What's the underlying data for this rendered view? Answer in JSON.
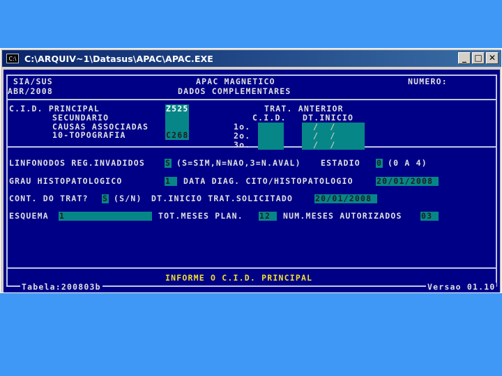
{
  "window": {
    "title": "C:\\ARQUIV~1\\Datasus\\APAC\\APAC.EXE",
    "icon_label": "C:\\",
    "icon": "console-icon"
  },
  "controls": {
    "minimize": "_",
    "maximize": "□",
    "close": "✕"
  },
  "header": {
    "system": "SIA/SUS",
    "period": "ABR/2008",
    "app_title": "APAC MAGNETICO",
    "section": "DADOS COMPLEMENTARES",
    "numero_label": "NUMERO:"
  },
  "cid": {
    "principal_label": "C.I.D. PRINCIPAL",
    "principal_value": "Z525",
    "secundario_label": "SECUNDARIO",
    "causas_label": "CAUSAS ASSOCIADAS",
    "topografia_label": "10-TOPOGRAFIA",
    "topografia_value": "C268"
  },
  "trat_anterior": {
    "title": "TRAT. ANTERIOR",
    "cid_col": "C.I.D.",
    "dt_col": "DT.INICIO",
    "rows": [
      {
        "label": "1o.",
        "date": "/  /"
      },
      {
        "label": "2o.",
        "date": "/  /"
      },
      {
        "label": "3o.",
        "date": "/  /"
      }
    ]
  },
  "linfonodos": {
    "label": "LINFONODOS REG.INVADIDOS",
    "value": "S",
    "hint": "(S=SIM,N=NAO,3=N.AVAL)",
    "estadio_label": "ESTADIO",
    "estadio_value": "0",
    "estadio_hint": "(0 A 4)"
  },
  "grau": {
    "label": "GRAU HISTOPATOLOGICO",
    "value": "1",
    "data_label": "DATA DIAG. CITO/HISTOPATOLOGIO",
    "data_value": "20/01/2008"
  },
  "cont": {
    "label": "CONT. DO TRAT?",
    "value": "S",
    "hint": "(S/N)",
    "dt_label": "DT.INICIO TRAT.SOLICITADO",
    "dt_value": "20/01/2008"
  },
  "esquema": {
    "label": "ESQUEMA",
    "value": "1",
    "tot_label": "TOT.MESES PLAN.",
    "tot_value": "12",
    "num_label": "NUM.MESES AUTORIZADOS",
    "num_value": "03"
  },
  "status": {
    "message": "INFORME O C.I.D. PRINCIPAL",
    "tabela": "Tabela:200803b",
    "versao": "Versao 01.10"
  }
}
